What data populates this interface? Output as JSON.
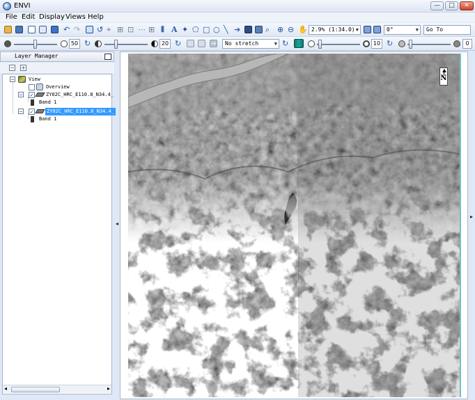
{
  "window": {
    "title": "ENVI",
    "minimize": "—",
    "maximize": "□",
    "close": "✕"
  },
  "menu": [
    "File",
    "Edit",
    "Display",
    "Views",
    "Help"
  ],
  "toolbar": {
    "zoom_value": "2.9% (1:34.0)",
    "rotation_value": "0°",
    "goto_label": "Go To",
    "brightness_value": "50",
    "contrast_value": "20",
    "stretch_value": "No stretch",
    "sharpen_value": "10",
    "transparency_value": "0"
  },
  "layer_manager": {
    "title": "Layer Manager",
    "items": [
      {
        "label": "View"
      },
      {
        "label": "Overview"
      },
      {
        "label": "ZY02C_HRC_E110.8_N34.4_"
      },
      {
        "label": "Band 1"
      },
      {
        "label": "ZY02C_HRC_E110.8_N34.4_"
      },
      {
        "label": "Band 1"
      }
    ]
  },
  "view": {
    "north_arrow": "N",
    "colors": {
      "cloud": "#f2f2f2",
      "terrain": "#5f5f5f",
      "river": "#a8a8a8"
    }
  }
}
